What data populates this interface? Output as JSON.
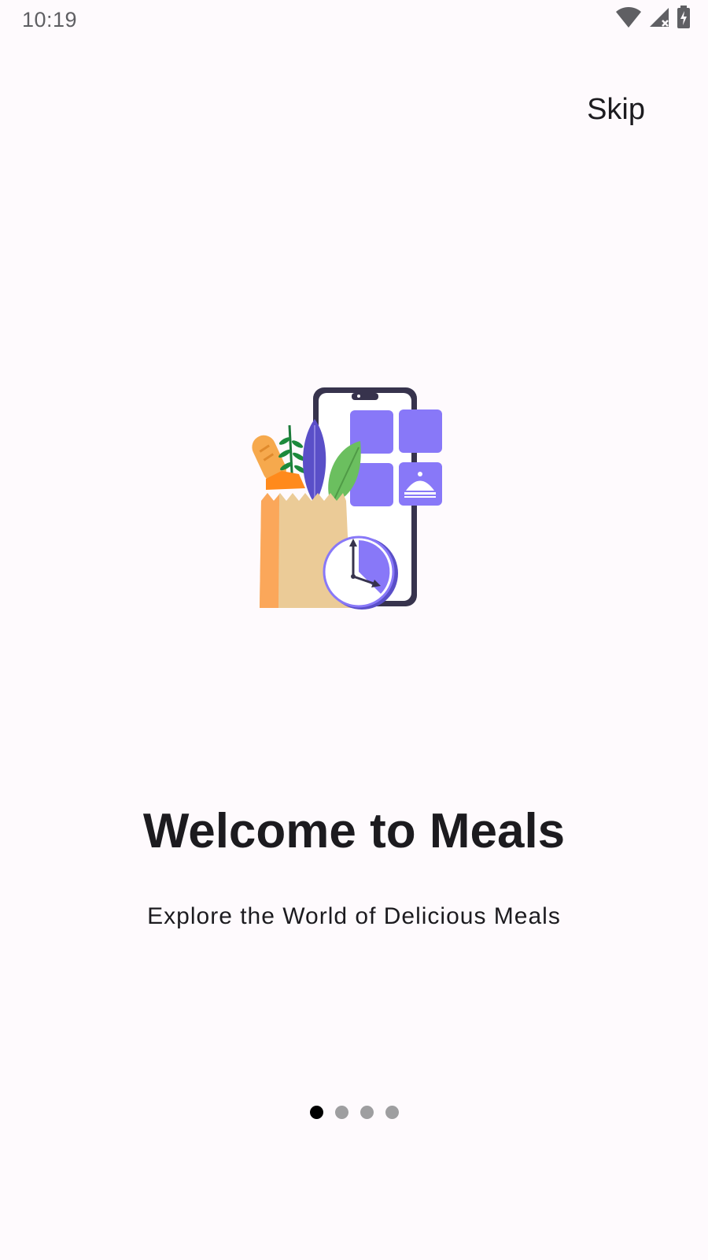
{
  "status_bar": {
    "time": "10:19",
    "icons": [
      "wifi-icon",
      "cellular-signal-icon",
      "battery-charging-icon"
    ]
  },
  "header": {
    "skip_label": "Skip"
  },
  "illustration": {
    "icon": "grocery-bag-phone-clock-illustration",
    "colors": {
      "accent": "#8878f8",
      "phone_frame": "#37334d",
      "bag": "#ebcb97",
      "bag_side": "#fba75a",
      "leaf_green": "#6bbf5f",
      "leaf_purple": "#5a4fc8"
    }
  },
  "main": {
    "title": "Welcome to Meals",
    "subtitle": "Explore the World of Delicious Meals"
  },
  "pager": {
    "count": 4,
    "active_index": 0,
    "active_color": "#000000",
    "inactive_color": "#9e9ea0"
  }
}
